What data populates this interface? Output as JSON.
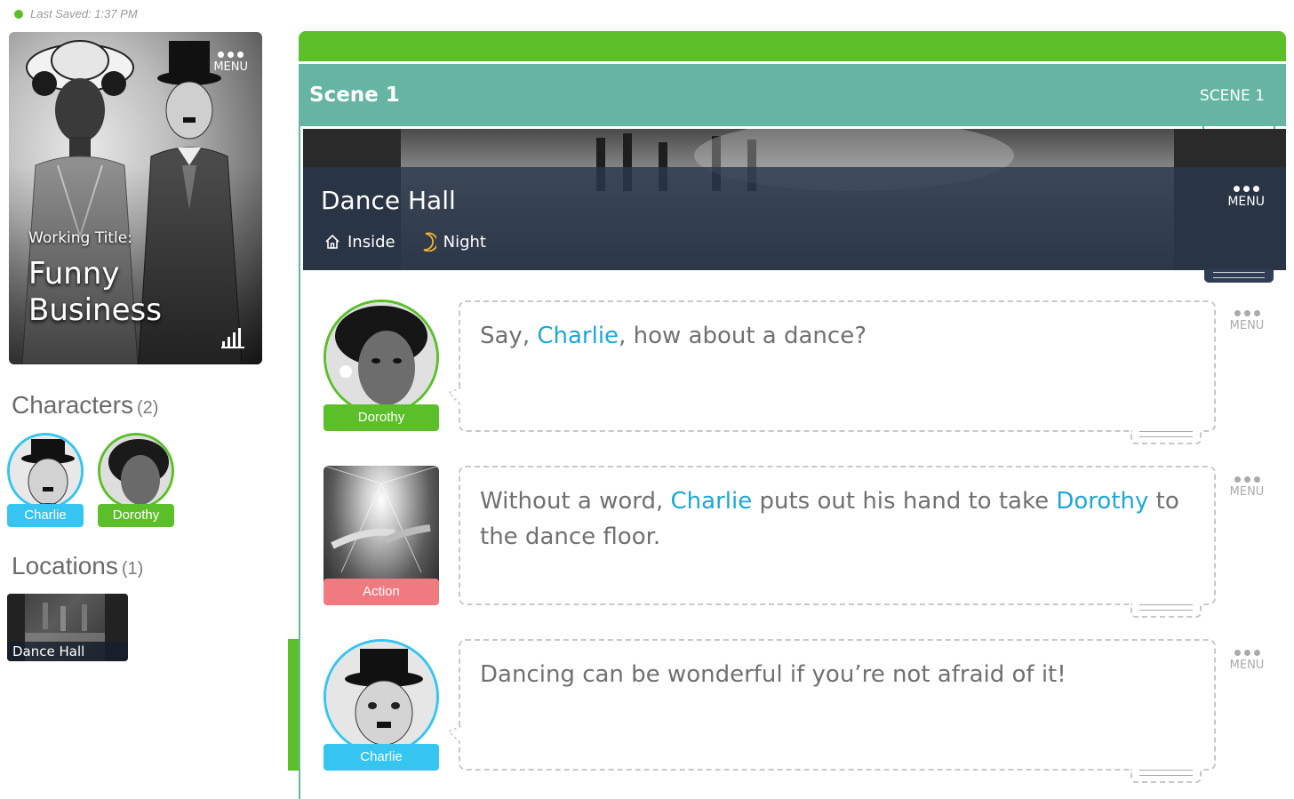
{
  "status": {
    "saved_text": "Last Saved: 1:37 PM"
  },
  "project": {
    "working_title_label": "Working Title:",
    "title_line1": "Funny",
    "title_line2": "Business",
    "menu_label": "MENU"
  },
  "sidebar": {
    "characters": {
      "title": "Characters",
      "count": "(2)",
      "items": [
        {
          "name": "Charlie"
        },
        {
          "name": "Dorothy"
        }
      ]
    },
    "locations": {
      "title": "Locations",
      "count": "(1)",
      "items": [
        {
          "name": "Dance Hall"
        }
      ]
    }
  },
  "scene": {
    "title": "Scene 1",
    "tag": "SCENE 1",
    "location": {
      "name": "Dance Hall",
      "setting": "Inside",
      "time": "Night",
      "menu_label": "MENU"
    },
    "blocks": [
      {
        "type": "dialogue",
        "speaker": "Dorothy",
        "parts": [
          {
            "t": "Say, "
          },
          {
            "t": "Charlie",
            "ref": true
          },
          {
            "t": ", how about a dance?"
          }
        ],
        "menu_label": "MENU"
      },
      {
        "type": "action",
        "speaker": "Action",
        "parts": [
          {
            "t": "Without a word, "
          },
          {
            "t": "Charlie",
            "ref": true
          },
          {
            "t": " puts out his hand to take "
          },
          {
            "t": "Dorothy",
            "ref": true
          },
          {
            "t": " to the dance floor."
          }
        ],
        "menu_label": "MENU"
      },
      {
        "type": "dialogue",
        "speaker": "Charlie",
        "parts": [
          {
            "t": "Dancing can be wonderful if you’re not afraid of it!"
          }
        ],
        "menu_label": "MENU"
      }
    ]
  },
  "colors": {
    "accent_green": "#5bbf2a",
    "scene_teal": "#65b5a2",
    "charlie_blue": "#35c5f0",
    "action_red": "#ef7b80",
    "reference_blue": "#1ea7d6"
  }
}
